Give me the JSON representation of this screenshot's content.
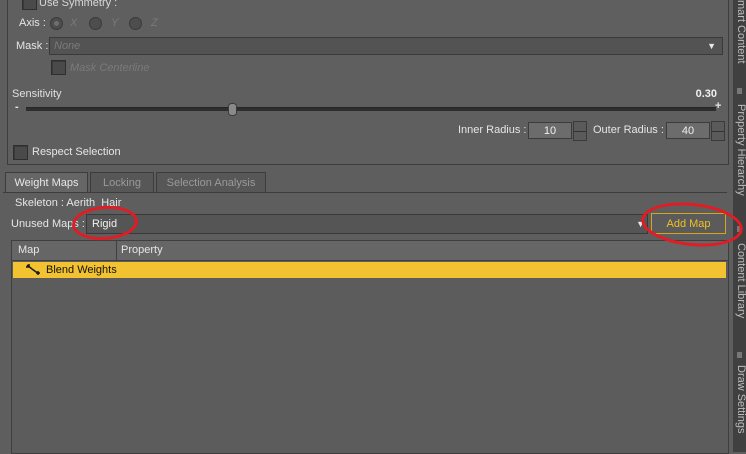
{
  "tool_options": {
    "use_symmetry_label": "Use Symmetry :",
    "axis_label": "Axis :",
    "axis_options": [
      "X",
      "Y",
      "Z"
    ],
    "mask_label": "Mask :",
    "mask_value": "None",
    "mask_centerline_label": "Mask Centerline",
    "sensitivity_label": "Sensitivity",
    "sensitivity_value": "0.30",
    "slider_minus": "-",
    "slider_plus": "+",
    "inner_radius_label": "Inner Radius :",
    "inner_radius_value": "10",
    "outer_radius_label": "Outer Radius :",
    "outer_radius_value": "40",
    "respect_selection_label": "Respect Selection"
  },
  "tabs": [
    {
      "label": "Weight Maps",
      "active": true
    },
    {
      "label": "Locking",
      "active": false
    },
    {
      "label": "Selection Analysis",
      "active": false
    }
  ],
  "weight_maps": {
    "skeleton_label": "Skeleton : Aerith_Hair",
    "unused_maps_label": "Unused Maps :",
    "unused_maps_value": "Rigid",
    "add_map_label": "Add Map",
    "columns": [
      "Map",
      "Property"
    ],
    "rows": [
      {
        "map": "Blend Weights",
        "property": "",
        "selected": true
      }
    ]
  },
  "side_tabs": [
    "mart Content",
    "Property Hierarchy",
    "Content Library",
    "Draw Settings"
  ],
  "colors": {
    "accent": "#f2c230",
    "annotation": "#e31b23"
  }
}
